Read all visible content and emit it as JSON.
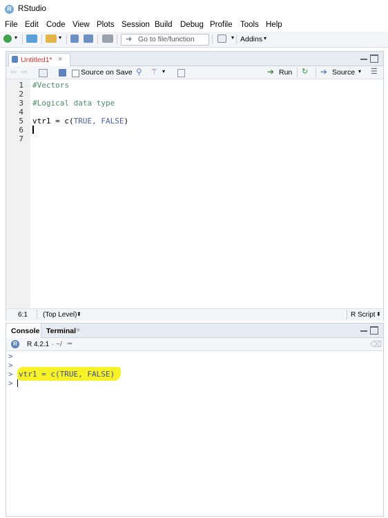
{
  "app": {
    "title": "RStudio",
    "logo_letter": "R"
  },
  "menu": [
    "File",
    "Edit",
    "Code",
    "View",
    "Plots",
    "Session",
    "Build",
    "Debug",
    "Profile",
    "Tools",
    "Help"
  ],
  "toolbar": {
    "goto_placeholder": "Go to file/function",
    "addins_label": "Addins"
  },
  "editor": {
    "tab_label": "Untitled1*",
    "source_on_save_label": "Source on Save",
    "run_label": "Run",
    "source_label": "Source",
    "line_numbers": [
      "1",
      "2",
      "3",
      "4",
      "5",
      "6",
      "7"
    ],
    "lines": {
      "l1": "#Vectors",
      "l3": "#Logical data type",
      "l5_var": "vtr1 = c(",
      "l5_args": "TRUE, FALSE",
      "l5_end": ")"
    },
    "status": {
      "position": "6:1",
      "scope": "(Top Level)",
      "filetype": "R Script"
    }
  },
  "console": {
    "tab_console": "Console",
    "tab_terminal": "Terminal",
    "r_version": "R 4.2.1",
    "working_dir": "· ~/",
    "prompt": ">",
    "command": "vtr1 = c(TRUE, FALSE)",
    "highlight_color": "#f7f227"
  }
}
